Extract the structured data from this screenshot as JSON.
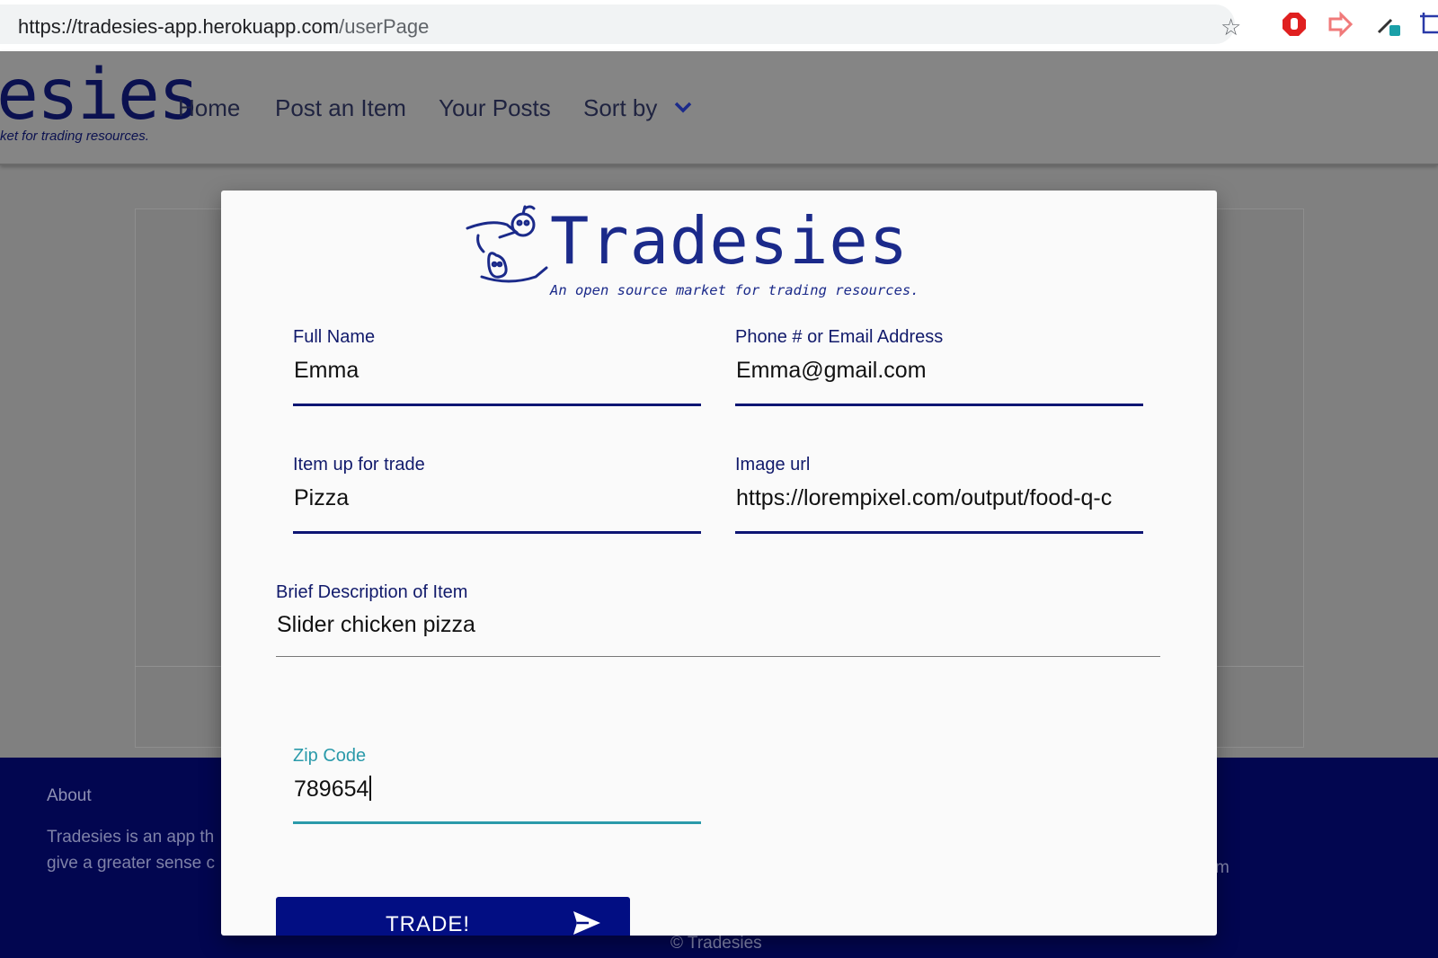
{
  "browser": {
    "url_main": "https://tradesies-app.herokuapp.com",
    "url_path": "/userPage",
    "star_icon": "star-icon",
    "extensions": [
      "stop-hand-icon",
      "arrow-icon",
      "eyedropper-icon",
      "crop-icon"
    ]
  },
  "navbar": {
    "logo_big": "esies",
    "logo_small": "ket for trading resources.",
    "links": [
      "Home",
      "Post an Item",
      "Your Posts",
      "Sort by"
    ],
    "sort_icon": "chevron-down-icon"
  },
  "footer": {
    "about": "About",
    "text_lines": [
      "Tradesies is an app th",
      "give a greater sense c"
    ],
    "fragment": "m",
    "copyright": "© Tradesies"
  },
  "modal": {
    "logo_title": "Tradesies",
    "logo_tagline": "An open source market for trading resources.",
    "fields": {
      "full_name": {
        "label": "Full Name",
        "value": "Emma"
      },
      "contact": {
        "label": "Phone # or Email Address",
        "value": "Emma@gmail.com"
      },
      "item": {
        "label": "Item up for trade",
        "value": "Pizza"
      },
      "image_url": {
        "label": "Image url",
        "value": "https://lorempixel.com/output/food-q-c"
      },
      "description": {
        "label": "Brief Description of Item",
        "value": "Slider chicken pizza"
      },
      "zip": {
        "label": "Zip Code",
        "value": "789654"
      }
    },
    "submit_label": "TRADE!",
    "submit_icon": "send-icon"
  },
  "colors": {
    "brand_navy": "#0d1573",
    "button_blue": "#020e83",
    "focus_teal": "#2a9aaa",
    "footer_bg": "#020650"
  }
}
